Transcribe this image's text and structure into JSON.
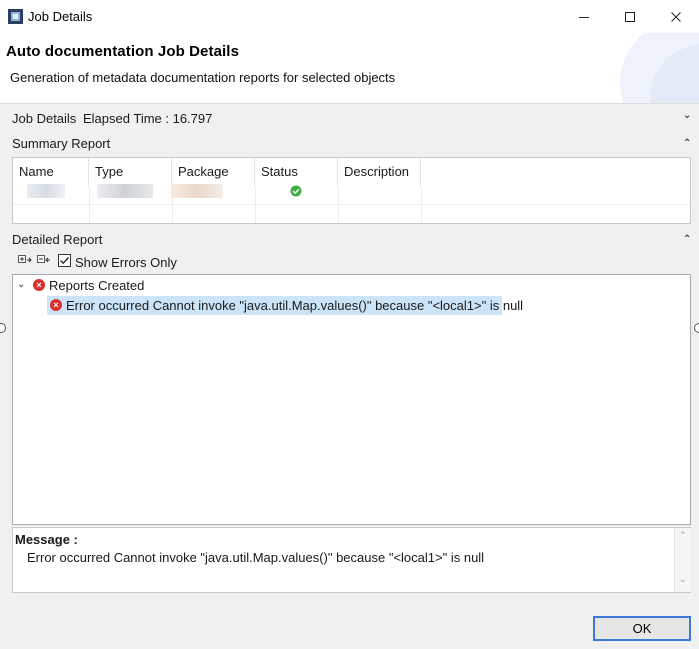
{
  "window": {
    "title": "Job Details"
  },
  "banner": {
    "title": "Auto documentation Job Details",
    "description": "Generation of metadata documentation reports for selected objects"
  },
  "job_details": {
    "label": "Job Details",
    "elapsed_label": "Elapsed Time : 16.797"
  },
  "summary": {
    "label": "Summary Report",
    "columns": [
      "Name",
      "Type",
      "Package",
      "Status",
      "Description"
    ]
  },
  "detailed": {
    "label": "Detailed Report",
    "show_errors_label": "Show Errors Only",
    "tree_root": "Reports Created",
    "error_item": "Error occurred Cannot invoke \"java.util.Map.values()\" because \"<local1>\" is null"
  },
  "message": {
    "label": "Message :",
    "text": "Error occurred Cannot invoke \"java.util.Map.values()\" because \"<local1>\" is null"
  },
  "buttons": {
    "ok": "OK"
  },
  "colors": {
    "selection": "#cce4f7",
    "error": "#d8312e",
    "status_ok": "#3fae49",
    "accent": "#3b7bd6"
  }
}
